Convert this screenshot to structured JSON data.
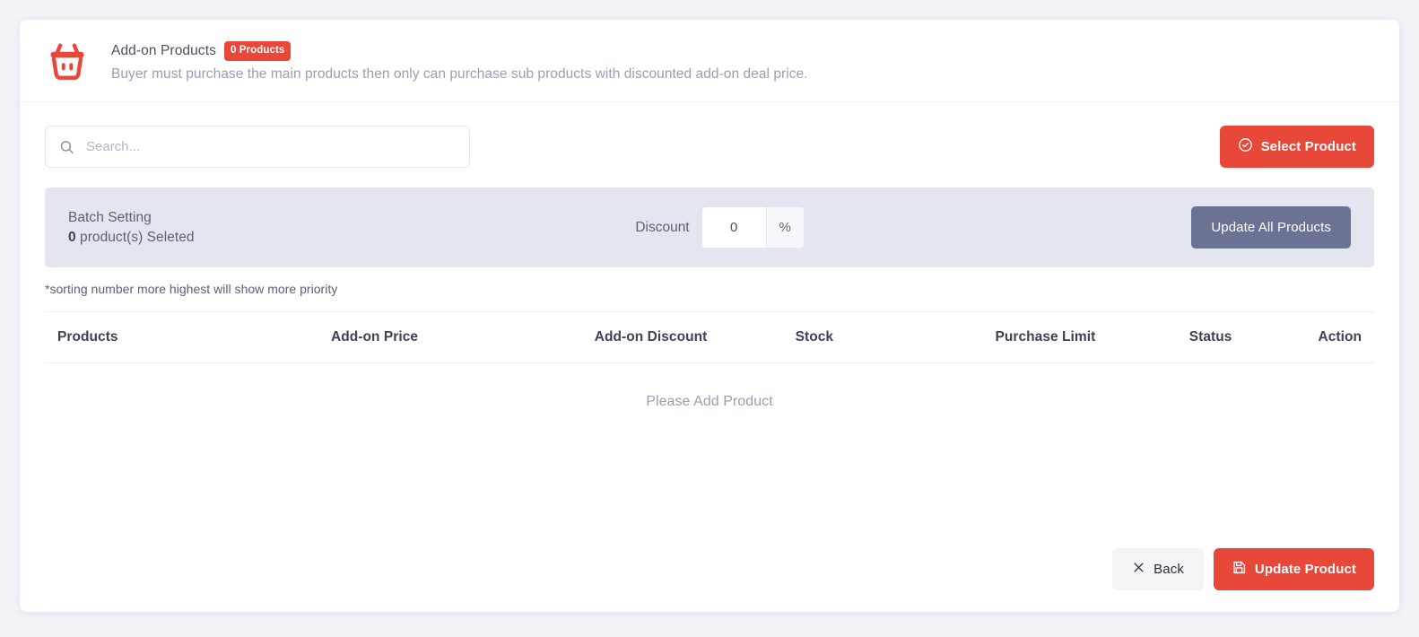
{
  "header": {
    "icon": "shopping-basket-icon",
    "title": "Add-on Products",
    "badge": "0 Products",
    "description": "Buyer must purchase the main products then only can purchase sub products with discounted add-on deal price."
  },
  "toolbar": {
    "search_placeholder": "Search...",
    "search_value": "",
    "search_icon": "search-icon",
    "select_product_label": "Select Product",
    "select_product_icon": "check-circle-icon"
  },
  "batch": {
    "title": "Batch Setting",
    "selected_count": "0",
    "selected_suffix": " product(s) Seleted",
    "discount_label": "Discount",
    "discount_value": "0",
    "discount_unit": "%",
    "update_all_label": "Update All Products"
  },
  "note": "*sorting number more highest will show more priority",
  "table": {
    "columns": [
      "Products",
      "Add-on Price",
      "Add-on Discount",
      "Stock",
      "Purchase Limit",
      "Status",
      "Action"
    ],
    "rows": [],
    "empty_text": "Please Add Product"
  },
  "footer": {
    "back_label": "Back",
    "back_icon": "close-x-icon",
    "update_label": "Update Product",
    "update_icon": "save-floppy-icon"
  },
  "colors": {
    "accent_red": "#e8483a",
    "slate": "#6c7293",
    "panel_gray": "#e4e6ef",
    "page_bg": "#f2f3f8",
    "text_dark": "#3f4254",
    "text_muted": "#9a9fb0"
  }
}
